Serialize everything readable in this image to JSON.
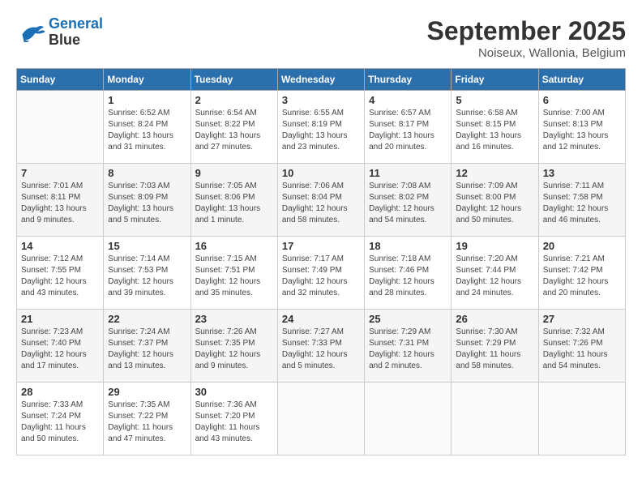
{
  "header": {
    "logo_line1": "General",
    "logo_line2": "Blue",
    "month_title": "September 2025",
    "location": "Noiseux, Wallonia, Belgium"
  },
  "days_of_week": [
    "Sunday",
    "Monday",
    "Tuesday",
    "Wednesday",
    "Thursday",
    "Friday",
    "Saturday"
  ],
  "weeks": [
    [
      {
        "day": "",
        "info": ""
      },
      {
        "day": "1",
        "info": "Sunrise: 6:52 AM\nSunset: 8:24 PM\nDaylight: 13 hours\nand 31 minutes."
      },
      {
        "day": "2",
        "info": "Sunrise: 6:54 AM\nSunset: 8:22 PM\nDaylight: 13 hours\nand 27 minutes."
      },
      {
        "day": "3",
        "info": "Sunrise: 6:55 AM\nSunset: 8:19 PM\nDaylight: 13 hours\nand 23 minutes."
      },
      {
        "day": "4",
        "info": "Sunrise: 6:57 AM\nSunset: 8:17 PM\nDaylight: 13 hours\nand 20 minutes."
      },
      {
        "day": "5",
        "info": "Sunrise: 6:58 AM\nSunset: 8:15 PM\nDaylight: 13 hours\nand 16 minutes."
      },
      {
        "day": "6",
        "info": "Sunrise: 7:00 AM\nSunset: 8:13 PM\nDaylight: 13 hours\nand 12 minutes."
      }
    ],
    [
      {
        "day": "7",
        "info": "Sunrise: 7:01 AM\nSunset: 8:11 PM\nDaylight: 13 hours\nand 9 minutes."
      },
      {
        "day": "8",
        "info": "Sunrise: 7:03 AM\nSunset: 8:09 PM\nDaylight: 13 hours\nand 5 minutes."
      },
      {
        "day": "9",
        "info": "Sunrise: 7:05 AM\nSunset: 8:06 PM\nDaylight: 13 hours\nand 1 minute."
      },
      {
        "day": "10",
        "info": "Sunrise: 7:06 AM\nSunset: 8:04 PM\nDaylight: 12 hours\nand 58 minutes."
      },
      {
        "day": "11",
        "info": "Sunrise: 7:08 AM\nSunset: 8:02 PM\nDaylight: 12 hours\nand 54 minutes."
      },
      {
        "day": "12",
        "info": "Sunrise: 7:09 AM\nSunset: 8:00 PM\nDaylight: 12 hours\nand 50 minutes."
      },
      {
        "day": "13",
        "info": "Sunrise: 7:11 AM\nSunset: 7:58 PM\nDaylight: 12 hours\nand 46 minutes."
      }
    ],
    [
      {
        "day": "14",
        "info": "Sunrise: 7:12 AM\nSunset: 7:55 PM\nDaylight: 12 hours\nand 43 minutes."
      },
      {
        "day": "15",
        "info": "Sunrise: 7:14 AM\nSunset: 7:53 PM\nDaylight: 12 hours\nand 39 minutes."
      },
      {
        "day": "16",
        "info": "Sunrise: 7:15 AM\nSunset: 7:51 PM\nDaylight: 12 hours\nand 35 minutes."
      },
      {
        "day": "17",
        "info": "Sunrise: 7:17 AM\nSunset: 7:49 PM\nDaylight: 12 hours\nand 32 minutes."
      },
      {
        "day": "18",
        "info": "Sunrise: 7:18 AM\nSunset: 7:46 PM\nDaylight: 12 hours\nand 28 minutes."
      },
      {
        "day": "19",
        "info": "Sunrise: 7:20 AM\nSunset: 7:44 PM\nDaylight: 12 hours\nand 24 minutes."
      },
      {
        "day": "20",
        "info": "Sunrise: 7:21 AM\nSunset: 7:42 PM\nDaylight: 12 hours\nand 20 minutes."
      }
    ],
    [
      {
        "day": "21",
        "info": "Sunrise: 7:23 AM\nSunset: 7:40 PM\nDaylight: 12 hours\nand 17 minutes."
      },
      {
        "day": "22",
        "info": "Sunrise: 7:24 AM\nSunset: 7:37 PM\nDaylight: 12 hours\nand 13 minutes."
      },
      {
        "day": "23",
        "info": "Sunrise: 7:26 AM\nSunset: 7:35 PM\nDaylight: 12 hours\nand 9 minutes."
      },
      {
        "day": "24",
        "info": "Sunrise: 7:27 AM\nSunset: 7:33 PM\nDaylight: 12 hours\nand 5 minutes."
      },
      {
        "day": "25",
        "info": "Sunrise: 7:29 AM\nSunset: 7:31 PM\nDaylight: 12 hours\nand 2 minutes."
      },
      {
        "day": "26",
        "info": "Sunrise: 7:30 AM\nSunset: 7:29 PM\nDaylight: 11 hours\nand 58 minutes."
      },
      {
        "day": "27",
        "info": "Sunrise: 7:32 AM\nSunset: 7:26 PM\nDaylight: 11 hours\nand 54 minutes."
      }
    ],
    [
      {
        "day": "28",
        "info": "Sunrise: 7:33 AM\nSunset: 7:24 PM\nDaylight: 11 hours\nand 50 minutes."
      },
      {
        "day": "29",
        "info": "Sunrise: 7:35 AM\nSunset: 7:22 PM\nDaylight: 11 hours\nand 47 minutes."
      },
      {
        "day": "30",
        "info": "Sunrise: 7:36 AM\nSunset: 7:20 PM\nDaylight: 11 hours\nand 43 minutes."
      },
      {
        "day": "",
        "info": ""
      },
      {
        "day": "",
        "info": ""
      },
      {
        "day": "",
        "info": ""
      },
      {
        "day": "",
        "info": ""
      }
    ]
  ]
}
